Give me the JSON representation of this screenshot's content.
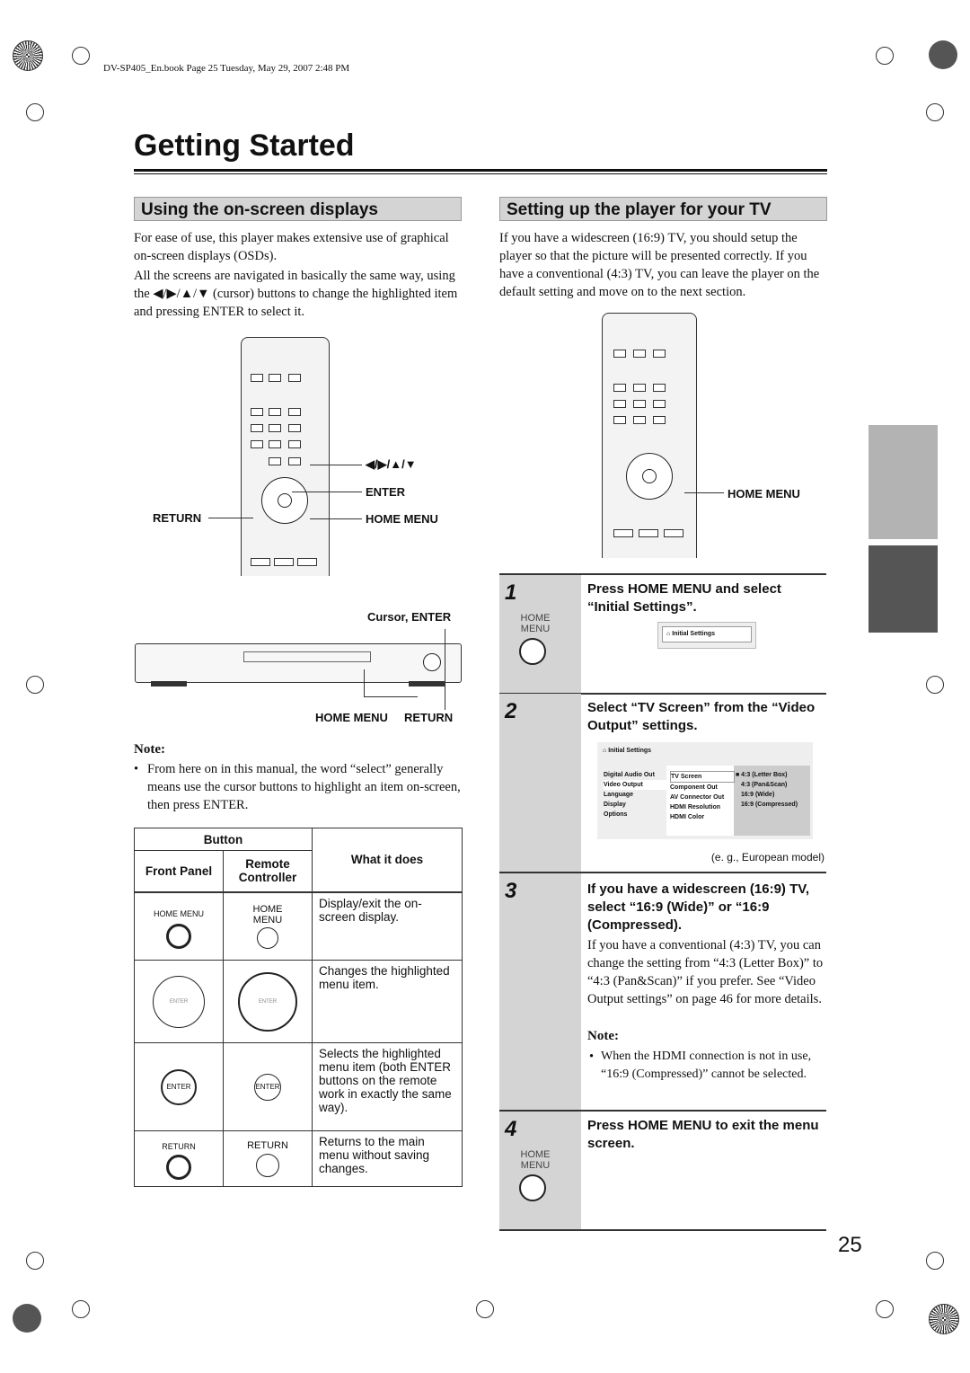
{
  "header": {
    "file_line": "DV-SP405_En.book  Page 25  Tuesday, May 29, 2007  2:48 PM"
  },
  "title": "Getting Started",
  "left": {
    "section": "Using the on-screen displays",
    "para1": "For ease of use, this player makes extensive use of graphical on-screen displays (OSDs).",
    "para2": "All the screens are navigated in basically the same way, using the ◀/▶/▲/▼ (cursor) buttons to change the highlighted item and pressing ENTER to select it.",
    "remote_labels": {
      "cursor": "◀/▶/▲/▼",
      "enter": "ENTER",
      "return": "RETURN",
      "home_menu": "HOME MENU"
    },
    "player_labels": {
      "cursor_enter": "Cursor, ENTER",
      "home_menu": "HOME MENU",
      "return": "RETURN"
    },
    "note_title": "Note:",
    "note": "From here on in this manual, the word “select” generally means use the cursor buttons to highlight an item on-screen, then press ENTER.",
    "table": {
      "h_button": "Button",
      "h_front": "Front Panel",
      "h_remote": "Remote Controller",
      "h_what": "What it does",
      "rows": [
        {
          "front": "HOME MENU",
          "remote": "HOME MENU",
          "what": "Display/exit the on-screen display."
        },
        {
          "front": "ENTER",
          "remote": "ENTER",
          "what": "Changes the highlighted menu item."
        },
        {
          "front": "ENTER",
          "remote": "ENTER",
          "what": "Selects the highlighted menu item (both ENTER buttons on the remote work in exactly the same way)."
        },
        {
          "front": "RETURN",
          "remote": "RETURN",
          "what": "Returns to the main menu without saving changes."
        }
      ]
    }
  },
  "right": {
    "section": "Setting up the player for your TV",
    "para": "If you have a widescreen (16:9) TV, you should setup the player so that the picture will be presented correctly. If you have a conventional (4:3) TV, you can leave the player on the default setting and move on to the next section.",
    "remote_label": "HOME MENU",
    "steps": [
      {
        "num": "1",
        "head": "Press HOME MENU and select “Initial Settings”.",
        "icon_label": "HOME MENU",
        "osd": "Initial Settings"
      },
      {
        "num": "2",
        "head": "Select “TV Screen” from the “Video Output” settings.",
        "caption": "(e. g., European model)",
        "osd": {
          "title": "Initial Settings",
          "col1": [
            "Digital Audio Out",
            "Video Output",
            "Language",
            "Display",
            "Options"
          ],
          "col2": [
            "TV Screen",
            "Component Out",
            "AV Connector Out",
            "HDMI Resolution",
            "HDMI Color"
          ],
          "col3": [
            "■ 4:3 (Letter Box)",
            "4:3 (Pan&Scan)",
            "16:9 (Wide)",
            "16:9 (Compressed)"
          ]
        }
      },
      {
        "num": "3",
        "head": "If you have a widescreen (16:9) TV, select “16:9 (Wide)” or “16:9 (Compressed).",
        "body": "If you have a conventional (4:3) TV, you can change the setting from “4:3 (Letter Box)” to “4:3 (Pan&Scan)” if you prefer. See “Video Output settings” on page 46 for more details.",
        "note_title": "Note:",
        "note": "When the HDMI connection is not in use, “16:9 (Compressed)” cannot be selected."
      },
      {
        "num": "4",
        "head": "Press HOME MENU to exit the menu screen.",
        "icon_label": "HOME MENU"
      }
    ]
  },
  "page_number": "25",
  "colors": {
    "section_bg": "#d4d4d4",
    "tab_light": "#b3b3b3",
    "tab_dark": "#555555"
  }
}
